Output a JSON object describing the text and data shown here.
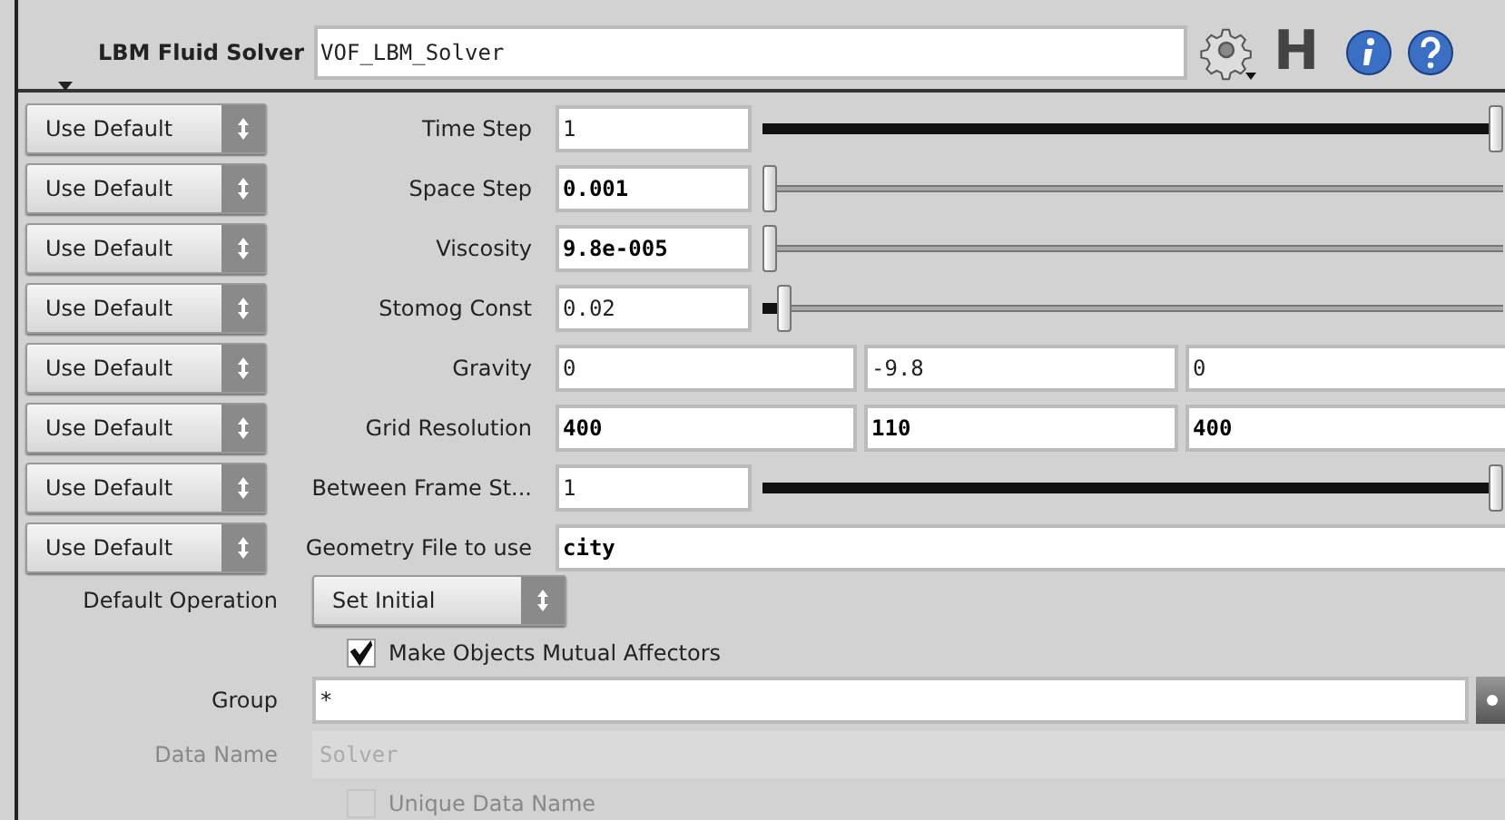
{
  "header": {
    "title": "LBM Fluid Solver",
    "node_name": "VOF_LBM_Solver",
    "h_menu": "H"
  },
  "parms": [
    {
      "kind": "slider",
      "button": "Use Default",
      "label": "Time Step",
      "value": "1",
      "changed": false,
      "level": 1
    },
    {
      "kind": "slider",
      "button": "Use Default",
      "label": "Space Step",
      "value": "0.001",
      "changed": true,
      "level": 0
    },
    {
      "kind": "slider",
      "button": "Use Default",
      "label": "Viscosity",
      "value": "9.8e-005",
      "changed": true,
      "level": 0
    },
    {
      "kind": "slider",
      "button": "Use Default",
      "label": "Stomog Const",
      "value": "0.02",
      "changed": false,
      "level": 0.02
    },
    {
      "kind": "vector",
      "button": "Use Default",
      "label": "Gravity",
      "values": [
        "0",
        "-9.8",
        "0"
      ],
      "changed": false
    },
    {
      "kind": "vector",
      "button": "Use Default",
      "label": "Grid Resolution",
      "values": [
        "400",
        "110",
        "400"
      ],
      "changed": true
    },
    {
      "kind": "slider",
      "button": "Use Default",
      "label": "Between Frame St...",
      "value": "1",
      "changed": false,
      "level": 1
    },
    {
      "kind": "text",
      "button": "Use Default",
      "label": "Geometry File to use",
      "value": "city",
      "changed": true
    }
  ],
  "default_operation": {
    "label": "Default Operation",
    "value": "Set Initial"
  },
  "mutual_affectors": {
    "label": "Make Objects Mutual Affectors",
    "checked": true
  },
  "group": {
    "label": "Group",
    "value": "*"
  },
  "data_name": {
    "label": "Data Name",
    "value": "Solver",
    "disabled": true
  },
  "unique_data_name": {
    "label": "Unique Data Name",
    "checked": false,
    "disabled": true
  }
}
